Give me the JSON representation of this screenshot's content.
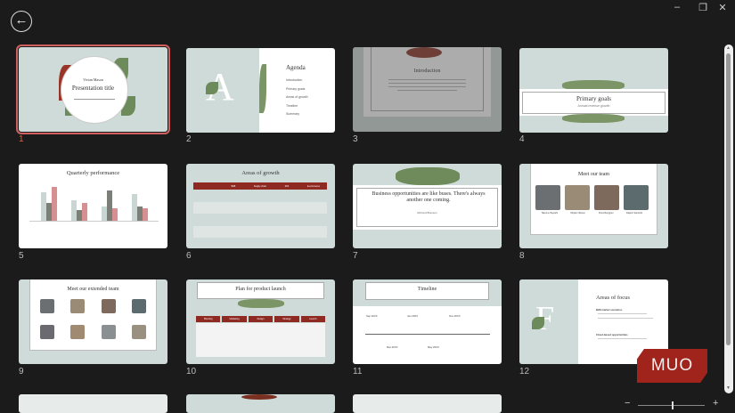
{
  "window": {
    "minimize": "–",
    "restore": "❐",
    "close": "✕",
    "back": "←"
  },
  "slides": [
    {
      "number": "1",
      "selected": true,
      "presenter": "Vivian Mason",
      "title": "Presentation title"
    },
    {
      "number": "2",
      "letter": "A",
      "title": "Agenda",
      "items": [
        "Introduction",
        "Primary goals",
        "Areas of growth",
        "Timeline",
        "Summary"
      ]
    },
    {
      "number": "3",
      "title": "Introduction"
    },
    {
      "number": "4",
      "title": "Primary goals",
      "subtitle": "Annual revenue growth"
    },
    {
      "number": "5",
      "title": "Quarterly performance"
    },
    {
      "number": "6",
      "title": "Areas of growth",
      "headers": [
        "B2B",
        "Supply chain",
        "ROI",
        "E-commerce"
      ]
    },
    {
      "number": "7",
      "quote": "Business opportunities are like buses. There's always another one coming.",
      "author": "Richard Branson"
    },
    {
      "number": "8",
      "title": "Meet our team",
      "names": [
        "Takuma Hayashi",
        "Mirjam Nilsson",
        "Flora Berggren",
        "Rajesh Santoshi"
      ]
    },
    {
      "number": "9",
      "title": "Meet our extended team"
    },
    {
      "number": "10",
      "title": "Plan for product launch",
      "headers": [
        "Planning",
        "Marketing",
        "Design",
        "Strategy",
        "Launch"
      ]
    },
    {
      "number": "11",
      "title": "Timeline",
      "dates": [
        "Sep 20XX",
        "Jan 20XX",
        "Nov 20XX",
        "Mar 20XX",
        "May 20XX"
      ]
    },
    {
      "number": "12",
      "letter": "F",
      "title": "Areas of focus",
      "sections": [
        "B2B market scenarios",
        "Cloud-based opportunities"
      ]
    }
  ],
  "zoom": {
    "minus": "−",
    "plus": "+",
    "level": 0.5
  },
  "watermark": "MUO",
  "colors": {
    "accent": "#8f2a22",
    "slide_bg": "#cfdbd8",
    "selected": "#d06060"
  }
}
